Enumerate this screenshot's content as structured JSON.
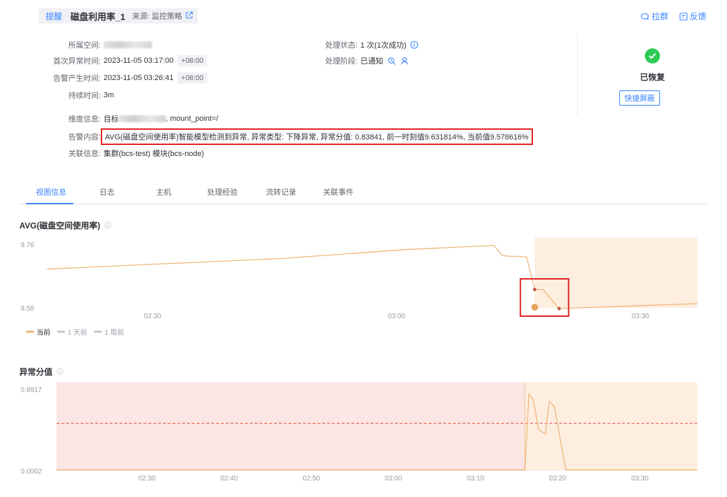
{
  "header": {
    "tag": "提醒",
    "title": "磁盘利用率_1",
    "source": "来源: 监控策略"
  },
  "actions": {
    "group": "拉群",
    "feedback": "反馈"
  },
  "info": {
    "space_label": "所属空间:",
    "first_abnormal_label": "首次异常时间:",
    "first_abnormal_value": "2023-11-05 03:17:00",
    "first_abnormal_tz": "+08:00",
    "alert_time_label": "告警产生时间:",
    "alert_time_value": "2023-11-05 03:26:41",
    "alert_time_tz": "+08:00",
    "duration_label": "持续时间:",
    "duration_value": "3m",
    "status_label": "处理状态:",
    "status_value": "1 次(1次成功)",
    "stage_label": "处理阶段:",
    "stage_value": "已通知",
    "dimension_label": "维度信息:",
    "dimension_prefix": "目标",
    "dimension_suffix": ", mount_point=/",
    "content_label": "告警内容:",
    "content_value": "AVG(磁盘空间使用率)智能模型检测到异常, 异常类型: 下降异常, 异常分值: 0.83841, 前一时刻值9.631814%, 当前值9.578616%",
    "related_label": "关联信息:",
    "related_value": "集群(bcs-test) 模块(bcs-node)"
  },
  "status_card": {
    "label": "已恢复",
    "button": "快捷屏蔽"
  },
  "tabs": [
    "视图信息",
    "日志",
    "主机",
    "处理经验",
    "流转记录",
    "关联事件"
  ],
  "legend": [
    "当前",
    "1 天前",
    "1 周前"
  ],
  "colors": {
    "accent": "#3a84ff",
    "series": "#f0b77a",
    "anomaly_point": "#c0503e",
    "band_orange": "#fdeee0",
    "band_red": "#fbe6e3",
    "threshold": "#e5483e",
    "success": "#2dcb56",
    "highlight_box": "#e02020"
  },
  "chart_data": [
    {
      "type": "line",
      "title": "AVG(磁盘空间使用率)",
      "x_ticks": [
        "02:30",
        "03:00",
        "03:30"
      ],
      "y_ticks": [
        "9.76",
        "9.58"
      ],
      "ylim": [
        9.58,
        9.76
      ],
      "series": [
        {
          "name": "当前",
          "x": [
            "02:17",
            "02:46",
            "03:01",
            "03:12",
            "03:13",
            "03:14",
            "03:15",
            "03:16",
            "03:17",
            "03:18",
            "03:20",
            "03:37"
          ],
          "values": [
            9.69,
            9.72,
            9.745,
            9.757,
            9.728,
            9.726,
            9.726,
            9.724,
            9.632,
            9.632,
            9.578,
            9.592
          ]
        }
      ],
      "anomaly_points": [
        {
          "x": "03:17",
          "value": 9.632
        },
        {
          "x": "03:20",
          "value": 9.578
        }
      ],
      "alert_point": {
        "x": "03:17",
        "value": 9.58
      },
      "highlight_range": [
        "03:17",
        "03:37"
      ],
      "legend_position": "bottom-left"
    },
    {
      "type": "line",
      "title": "异常分值",
      "x_ticks": [
        "02:30",
        "02:40",
        "02:50",
        "03:00",
        "03:10",
        "03:20",
        "03:30"
      ],
      "y_ticks": [
        "0.8917",
        "0.0002"
      ],
      "ylim": [
        0.0002,
        0.8917
      ],
      "threshold": 0.52,
      "series": [
        {
          "name": "异常分值",
          "x": [
            "02:19",
            "03:16",
            "03:16.5",
            "03:17",
            "03:17.7",
            "03:18.5",
            "03:19",
            "03:19.6",
            "03:20.2",
            "03:21",
            "03:37"
          ],
          "values": [
            0.01,
            0.01,
            0.84,
            0.78,
            0.45,
            0.4,
            0.76,
            0.7,
            0.4,
            0.01,
            0.01
          ]
        }
      ],
      "highlight_range": [
        "03:16",
        "03:37"
      ]
    }
  ]
}
